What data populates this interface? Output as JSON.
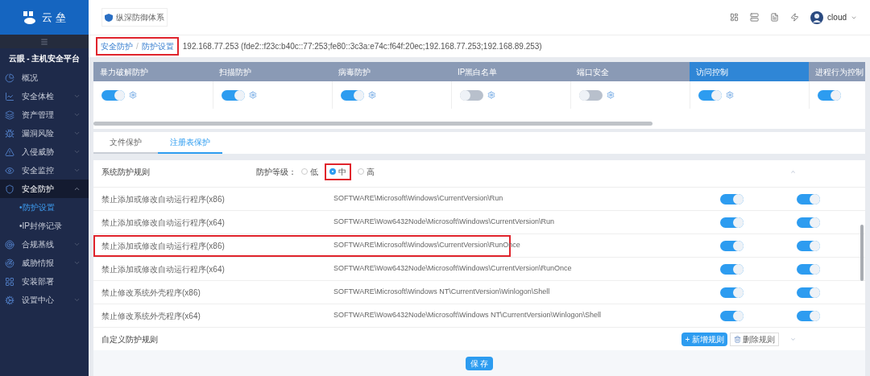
{
  "brand": {
    "name": "云 垒"
  },
  "platform_title": "云眼 - 主机安全平台",
  "sidebar": {
    "items": [
      {
        "label": "概况",
        "selected": false
      },
      {
        "label": "安全体检",
        "expanded": false,
        "selected": false
      },
      {
        "label": "资产管理",
        "expanded": false,
        "selected": false
      },
      {
        "label": "漏洞风险",
        "expanded": false,
        "selected": false
      },
      {
        "label": "入侵威胁",
        "expanded": false,
        "selected": false
      },
      {
        "label": "安全监控",
        "expanded": false,
        "selected": false
      },
      {
        "label": "安全防护",
        "expanded": true,
        "selected": true,
        "children": [
          {
            "label": "•防护设置",
            "selected": true
          },
          {
            "label": "•IP封停记录",
            "selected": false
          }
        ]
      },
      {
        "label": "合规基线",
        "expanded": false,
        "selected": false
      },
      {
        "label": "威胁情报",
        "expanded": false,
        "selected": false
      },
      {
        "label": "安装部署",
        "selected": false
      },
      {
        "label": "设置中心",
        "expanded": false,
        "selected": false
      }
    ]
  },
  "header": {
    "product": "纵深防御体系",
    "user": "cloud"
  },
  "breadcrumb": {
    "items": [
      "安全防护",
      "防护设置"
    ],
    "separator": "/",
    "highlighted": true,
    "host": "192.168.77.253 (fde2::f23c:b40c::77:253;fe80::3c3a:e74c:f64f:20ec;192.168.77.253;192.168.89.253)"
  },
  "modules": [
    {
      "label": "暴力破解防护",
      "on": true,
      "selected": false
    },
    {
      "label": "扫描防护",
      "on": true,
      "selected": false
    },
    {
      "label": "病毒防护",
      "on": true,
      "selected": false
    },
    {
      "label": "IP黑白名单",
      "on": false,
      "selected": false
    },
    {
      "label": "端口安全",
      "on": false,
      "selected": false
    },
    {
      "label": "访问控制",
      "on": true,
      "selected": true
    },
    {
      "label": "进程行为控制",
      "on": true,
      "selected": false
    }
  ],
  "tabs": [
    {
      "label": "文件保护",
      "selected": false
    },
    {
      "label": "注册表保护",
      "selected": true
    }
  ],
  "rules": {
    "title": "系统防护规则",
    "level_label": "防护等级：",
    "levels": [
      {
        "label": "低",
        "selected": false,
        "highlighted": false
      },
      {
        "label": "中",
        "selected": true,
        "highlighted": true
      },
      {
        "label": "高",
        "selected": false,
        "highlighted": false
      }
    ],
    "rows": [
      {
        "name": "禁止添加或修改自动运行程序(x86)",
        "path": "SOFTWARE\\Microsoft\\Windows\\CurrentVersion\\Run",
        "on_1": true,
        "on_2": true,
        "highlighted": false
      },
      {
        "name": "禁止添加或修改自动运行程序(x64)",
        "path": "SOFTWARE\\Wow6432Node\\Microsoft\\Windows\\CurrentVersion\\Run",
        "on_1": true,
        "on_2": true,
        "highlighted": false
      },
      {
        "name": "禁止添加或修改自动运行程序(x86)",
        "path": "SOFTWARE\\Microsoft\\Windows\\CurrentVersion\\RunOnce",
        "on_1": true,
        "on_2": true,
        "highlighted": true
      },
      {
        "name": "禁止添加或修改自动运行程序(x64)",
        "path": "SOFTWARE\\Wow6432Node\\Microsoft\\Windows\\CurrentVersion\\RunOnce",
        "on_1": true,
        "on_2": true,
        "highlighted": false
      },
      {
        "name": "禁止修改系统外壳程序(x86)",
        "path": "SOFTWARE\\Microsoft\\Windows NT\\CurrentVersion\\Winlogon\\Shell",
        "on_1": true,
        "on_2": true,
        "highlighted": false
      },
      {
        "name": "禁止修改系统外壳程序(x64)",
        "path": "SOFTWARE\\Wow6432Node\\Microsoft\\Windows NT\\CurrentVersion\\Winlogon\\Shell",
        "on_1": true,
        "on_2": true,
        "highlighted": false
      }
    ],
    "custom_title": "自定义防护规则",
    "add_button": "+ 新增规则",
    "delete_button": "删除规则"
  },
  "save_button": "保 存"
}
